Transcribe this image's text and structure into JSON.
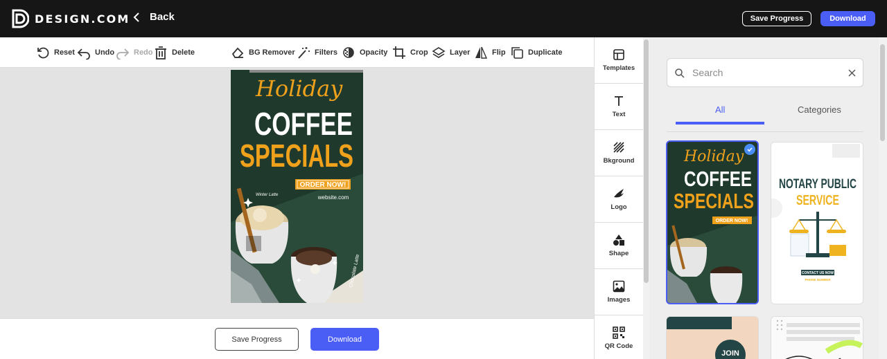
{
  "header": {
    "brand": "DESIGN.COM",
    "back_label": "Back",
    "save_progress_label": "Save Progress",
    "download_label": "Download"
  },
  "toolbar": {
    "reset": "Reset",
    "undo": "Undo",
    "redo": "Redo",
    "delete": "Delete",
    "bg_remover": "BG Remover",
    "filters": "Filters",
    "opacity": "Opacity",
    "crop": "Crop",
    "layer": "Layer",
    "flip": "Flip",
    "duplicate": "Duplicate"
  },
  "design": {
    "holiday": "Holiday",
    "coffee": "COFFEE",
    "specials": "SPECIALS",
    "cta": "ORDER NOW!",
    "website": "website.com",
    "winter_latte": "Winter Latte",
    "chocolate_latte": "Chocolate Latte",
    "colors": {
      "bg": "#1f3a2c",
      "accent": "#f0a11c",
      "white": "#ffffff"
    }
  },
  "bottombar": {
    "save_progress_label": "Save Progress",
    "download_label": "Download"
  },
  "sidetools": [
    {
      "label": "Templates",
      "icon": "templates-icon"
    },
    {
      "label": "Text",
      "icon": "text-icon"
    },
    {
      "label": "Bkground",
      "icon": "background-icon"
    },
    {
      "label": "Logo",
      "icon": "logo-icon"
    },
    {
      "label": "Shape",
      "icon": "shape-icon"
    },
    {
      "label": "Images",
      "icon": "image-icon"
    },
    {
      "label": "QR Code",
      "icon": "qr-code-icon"
    }
  ],
  "panel": {
    "search_placeholder": "Search",
    "tabs": [
      {
        "label": "All",
        "active": true
      },
      {
        "label": "Categories",
        "active": false
      }
    ],
    "templates": [
      {
        "line1": "Holiday",
        "line2": "COFFEE",
        "line3": "SPECIALS",
        "cta": "ORDER NOW!",
        "selected": true
      },
      {
        "line1": "NOTARY PUBLIC",
        "line2": "SERVICE",
        "cta": "CONTACT US NOW",
        "sub": "PHONE NUMBER",
        "selected": false
      },
      {
        "line1": "JOIN",
        "selected": false
      },
      {
        "selected": false
      }
    ]
  },
  "colors": {
    "accent": "#4a5df5",
    "topbar": "#161616"
  }
}
